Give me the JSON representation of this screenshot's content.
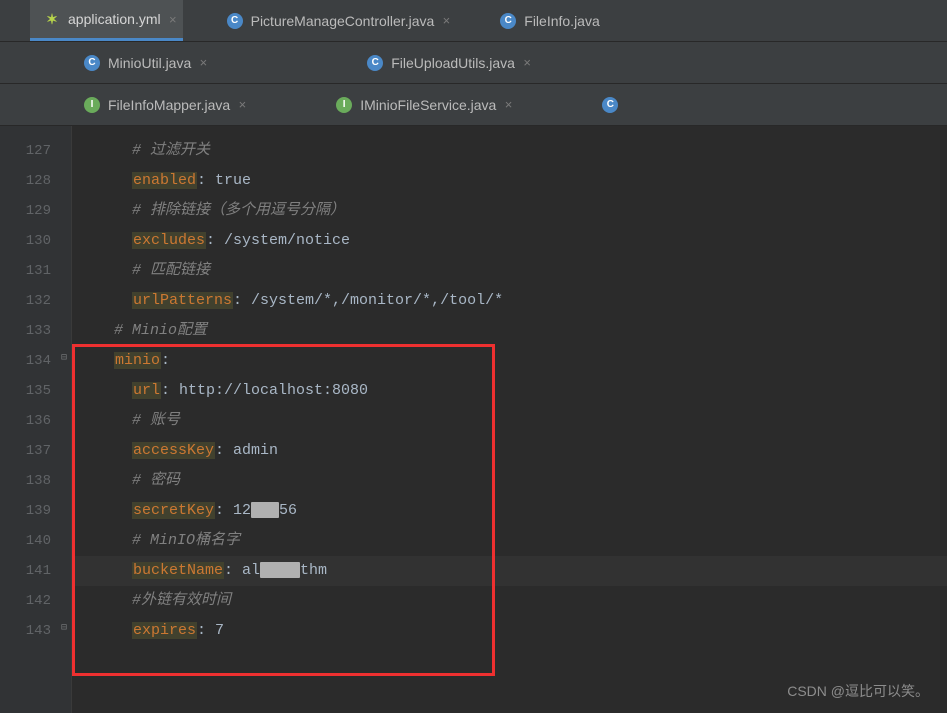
{
  "tabs_row1": [
    {
      "label": "application.yml",
      "icon": "yml",
      "active": true
    },
    {
      "label": "PictureManageController.java",
      "icon": "c",
      "active": false
    },
    {
      "label": "FileInfo.java",
      "icon": "c",
      "active": false
    }
  ],
  "tabs_row2": [
    {
      "label": "MinioUtil.java",
      "icon": "c",
      "active": false
    },
    {
      "label": "FileUploadUtils.java",
      "icon": "c",
      "active": false
    }
  ],
  "tabs_row3": [
    {
      "label": "FileInfoMapper.java",
      "icon": "i",
      "active": false
    },
    {
      "label": "IMinioFileService.java",
      "icon": "i",
      "active": false
    }
  ],
  "gutter": {
    "start": 127,
    "end": 143
  },
  "code": {
    "l127": {
      "comment": "# 过滤开关"
    },
    "l128": {
      "key": "enabled",
      "val": ": true"
    },
    "l129": {
      "comment": "# 排除链接（多个用逗号分隔）"
    },
    "l130": {
      "key": "excludes",
      "val": ": /system/notice"
    },
    "l131": {
      "comment": "# 匹配链接"
    },
    "l132": {
      "key": "urlPatterns",
      "val": ": /system/*,/monitor/*,/tool/*"
    },
    "l133": {
      "comment": "# Minio配置"
    },
    "l134": {
      "key": "minio",
      "val": ":"
    },
    "l135": {
      "key": "url",
      "val": ": http://localhost:8080"
    },
    "l136": {
      "comment": "# 账号"
    },
    "l137": {
      "key": "accessKey",
      "val": ": admin"
    },
    "l138": {
      "comment": "# 密码"
    },
    "l139": {
      "key": "secretKey",
      "val_a": ": 12",
      "val_b": "56"
    },
    "l140": {
      "comment": "# MinIO桶名字"
    },
    "l141": {
      "key": "bucketName",
      "val_a": ": al",
      "val_b": "thm"
    },
    "l142": {
      "comment": "#外链有效时间"
    },
    "l143": {
      "key": "expires",
      "val": ": 7"
    }
  },
  "watermark": "CSDN @逗比可以笑。"
}
